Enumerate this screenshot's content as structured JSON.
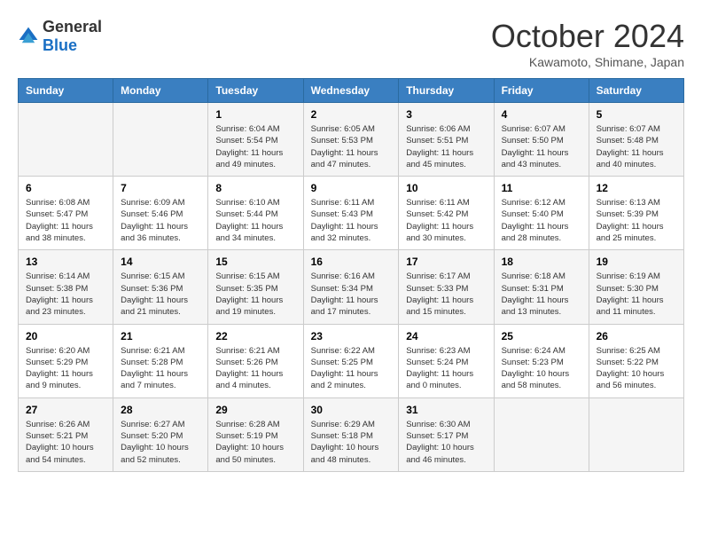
{
  "logo": {
    "general": "General",
    "blue": "Blue"
  },
  "title": "October 2024",
  "location": "Kawamoto, Shimane, Japan",
  "headers": [
    "Sunday",
    "Monday",
    "Tuesday",
    "Wednesday",
    "Thursday",
    "Friday",
    "Saturday"
  ],
  "weeks": [
    [
      {
        "day": "",
        "info": ""
      },
      {
        "day": "",
        "info": ""
      },
      {
        "day": "1",
        "info": "Sunrise: 6:04 AM\nSunset: 5:54 PM\nDaylight: 11 hours and 49 minutes."
      },
      {
        "day": "2",
        "info": "Sunrise: 6:05 AM\nSunset: 5:53 PM\nDaylight: 11 hours and 47 minutes."
      },
      {
        "day": "3",
        "info": "Sunrise: 6:06 AM\nSunset: 5:51 PM\nDaylight: 11 hours and 45 minutes."
      },
      {
        "day": "4",
        "info": "Sunrise: 6:07 AM\nSunset: 5:50 PM\nDaylight: 11 hours and 43 minutes."
      },
      {
        "day": "5",
        "info": "Sunrise: 6:07 AM\nSunset: 5:48 PM\nDaylight: 11 hours and 40 minutes."
      }
    ],
    [
      {
        "day": "6",
        "info": "Sunrise: 6:08 AM\nSunset: 5:47 PM\nDaylight: 11 hours and 38 minutes."
      },
      {
        "day": "7",
        "info": "Sunrise: 6:09 AM\nSunset: 5:46 PM\nDaylight: 11 hours and 36 minutes."
      },
      {
        "day": "8",
        "info": "Sunrise: 6:10 AM\nSunset: 5:44 PM\nDaylight: 11 hours and 34 minutes."
      },
      {
        "day": "9",
        "info": "Sunrise: 6:11 AM\nSunset: 5:43 PM\nDaylight: 11 hours and 32 minutes."
      },
      {
        "day": "10",
        "info": "Sunrise: 6:11 AM\nSunset: 5:42 PM\nDaylight: 11 hours and 30 minutes."
      },
      {
        "day": "11",
        "info": "Sunrise: 6:12 AM\nSunset: 5:40 PM\nDaylight: 11 hours and 28 minutes."
      },
      {
        "day": "12",
        "info": "Sunrise: 6:13 AM\nSunset: 5:39 PM\nDaylight: 11 hours and 25 minutes."
      }
    ],
    [
      {
        "day": "13",
        "info": "Sunrise: 6:14 AM\nSunset: 5:38 PM\nDaylight: 11 hours and 23 minutes."
      },
      {
        "day": "14",
        "info": "Sunrise: 6:15 AM\nSunset: 5:36 PM\nDaylight: 11 hours and 21 minutes."
      },
      {
        "day": "15",
        "info": "Sunrise: 6:15 AM\nSunset: 5:35 PM\nDaylight: 11 hours and 19 minutes."
      },
      {
        "day": "16",
        "info": "Sunrise: 6:16 AM\nSunset: 5:34 PM\nDaylight: 11 hours and 17 minutes."
      },
      {
        "day": "17",
        "info": "Sunrise: 6:17 AM\nSunset: 5:33 PM\nDaylight: 11 hours and 15 minutes."
      },
      {
        "day": "18",
        "info": "Sunrise: 6:18 AM\nSunset: 5:31 PM\nDaylight: 11 hours and 13 minutes."
      },
      {
        "day": "19",
        "info": "Sunrise: 6:19 AM\nSunset: 5:30 PM\nDaylight: 11 hours and 11 minutes."
      }
    ],
    [
      {
        "day": "20",
        "info": "Sunrise: 6:20 AM\nSunset: 5:29 PM\nDaylight: 11 hours and 9 minutes."
      },
      {
        "day": "21",
        "info": "Sunrise: 6:21 AM\nSunset: 5:28 PM\nDaylight: 11 hours and 7 minutes."
      },
      {
        "day": "22",
        "info": "Sunrise: 6:21 AM\nSunset: 5:26 PM\nDaylight: 11 hours and 4 minutes."
      },
      {
        "day": "23",
        "info": "Sunrise: 6:22 AM\nSunset: 5:25 PM\nDaylight: 11 hours and 2 minutes."
      },
      {
        "day": "24",
        "info": "Sunrise: 6:23 AM\nSunset: 5:24 PM\nDaylight: 11 hours and 0 minutes."
      },
      {
        "day": "25",
        "info": "Sunrise: 6:24 AM\nSunset: 5:23 PM\nDaylight: 10 hours and 58 minutes."
      },
      {
        "day": "26",
        "info": "Sunrise: 6:25 AM\nSunset: 5:22 PM\nDaylight: 10 hours and 56 minutes."
      }
    ],
    [
      {
        "day": "27",
        "info": "Sunrise: 6:26 AM\nSunset: 5:21 PM\nDaylight: 10 hours and 54 minutes."
      },
      {
        "day": "28",
        "info": "Sunrise: 6:27 AM\nSunset: 5:20 PM\nDaylight: 10 hours and 52 minutes."
      },
      {
        "day": "29",
        "info": "Sunrise: 6:28 AM\nSunset: 5:19 PM\nDaylight: 10 hours and 50 minutes."
      },
      {
        "day": "30",
        "info": "Sunrise: 6:29 AM\nSunset: 5:18 PM\nDaylight: 10 hours and 48 minutes."
      },
      {
        "day": "31",
        "info": "Sunrise: 6:30 AM\nSunset: 5:17 PM\nDaylight: 10 hours and 46 minutes."
      },
      {
        "day": "",
        "info": ""
      },
      {
        "day": "",
        "info": ""
      }
    ]
  ]
}
